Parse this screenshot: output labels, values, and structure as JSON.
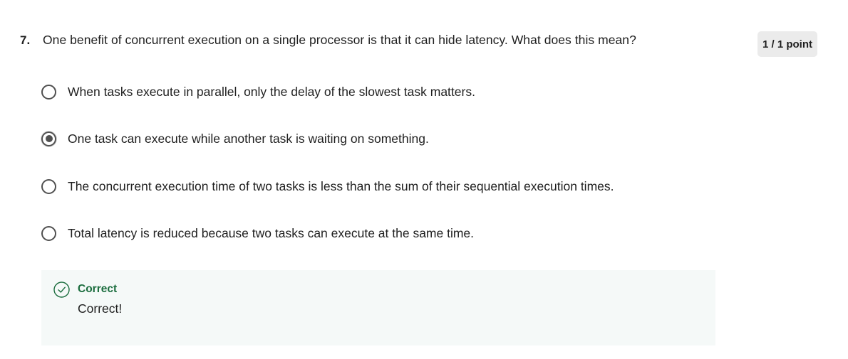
{
  "question": {
    "number": "7.",
    "text": "One benefit of concurrent execution on a single processor is that it can hide latency. What does this mean?",
    "points": "1 / 1 point"
  },
  "options": [
    {
      "label": "When tasks execute in parallel, only the delay of the slowest task matters.",
      "selected": false
    },
    {
      "label": "One task can execute while another task is waiting on something.",
      "selected": true
    },
    {
      "label": "The concurrent execution time of two tasks is less than the sum of their sequential execution times.",
      "selected": false
    },
    {
      "label": "Total latency is reduced because two tasks can execute at the same time.",
      "selected": false
    }
  ],
  "feedback": {
    "status": "Correct",
    "message": "Correct!",
    "icon": "check-circle-icon",
    "accent_color": "#1b6d3e",
    "background_color": "#f5f9f8"
  }
}
